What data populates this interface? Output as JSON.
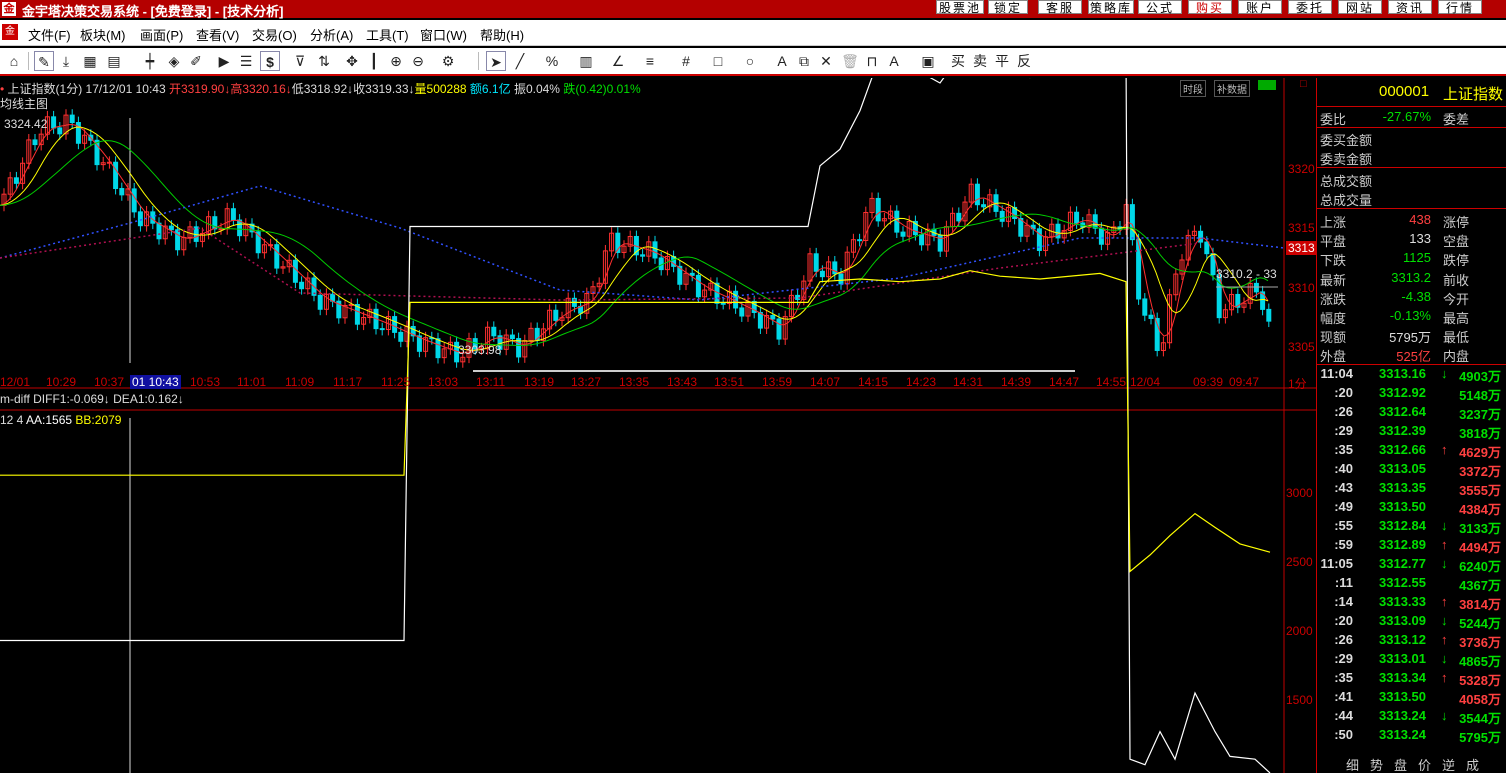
{
  "titlebar": {
    "title": "金宇塔决策交易系统 - [免费登录] - [技术分析]",
    "buttons": [
      "股票池",
      "锁定",
      "客服",
      "策略库",
      "公式",
      "购买",
      "账户",
      "委托",
      "网站",
      "资讯",
      "行情"
    ]
  },
  "menu": [
    "文件(F)",
    "板块(M)",
    "画面(P)",
    "查看(V)",
    "交易(O)",
    "分析(A)",
    "工具(T)",
    "窗口(W)",
    "帮助(H)"
  ],
  "chart": {
    "header": "上证指数(1分)  17/12/01 10:43",
    "open": "开3319.90↓",
    "high": "高3320.16↓",
    "low": "低3318.92↓",
    "close": "收3319.33↓",
    "volume": "量500288",
    "amount": "额6.1亿",
    "amplitude": "振0.04%",
    "change": "跌(0.42)0.01%",
    "main_label": "均线主图",
    "buttons": [
      "时段",
      "补数据"
    ],
    "high_label": "3324.42",
    "low_label": "3303.98",
    "right_marker_price": "3313",
    "overlay_label": "3310.2 - 33",
    "price_ticks": [
      "3320",
      "3315",
      "3310",
      "3305"
    ],
    "time_axis": [
      "12/01",
      "10:29",
      "10:37",
      "01 10:43",
      "10:53",
      "11:01",
      "11:09",
      "11:17",
      "11:25",
      "13:03",
      "13:11",
      "13:19",
      "13:27",
      "13:35",
      "13:43",
      "13:51",
      "13:59",
      "14:07",
      "14:15",
      "14:23",
      "14:31",
      "14:39",
      "14:47",
      "14:55",
      "12/04",
      "09:39",
      "09:47"
    ],
    "period_label": "1分",
    "indicator1": "m-diff  DIFF1:-0.069↓  DEA1:0.162↓",
    "indicator2_prefix": "12 4 ",
    "indicator2_aa": "AA:1565",
    "indicator2_bb": "BB:2079",
    "indicator_ticks": [
      "3000",
      "2500",
      "2000",
      "1500"
    ]
  },
  "quote": {
    "code": "000001",
    "name": "上证指数",
    "wei_bi_label": "委比",
    "wei_bi": "-27.67%",
    "wei_cha_label": "委差",
    "rows_plain": [
      "委买金额",
      "委卖金额",
      "总成交额",
      "总成交量"
    ],
    "stats": [
      {
        "l": "上涨",
        "v": "438",
        "c": "#ff4040",
        "r": "涨停"
      },
      {
        "l": "平盘",
        "v": "133",
        "c": "#dddddd",
        "r": "空盘"
      },
      {
        "l": "下跌",
        "v": "1125",
        "c": "#00e000",
        "r": "跌停"
      },
      {
        "l": "最新",
        "v": "3313.2",
        "c": "#00e000",
        "r": "前收"
      },
      {
        "l": "涨跌",
        "v": "-4.38",
        "c": "#00e000",
        "r": "今开"
      },
      {
        "l": "幅度",
        "v": "-0.13%",
        "c": "#00e000",
        "r": "最高"
      },
      {
        "l": "现额",
        "v": "5795万",
        "c": "#dddddd",
        "r": "最低"
      },
      {
        "l": "外盘",
        "v": "525亿",
        "c": "#ff4040",
        "r": "内盘"
      }
    ],
    "ticks": [
      {
        "t": "11:04",
        "p": "3313.16",
        "a": "↓",
        "v": "4903万",
        "c": "#00e000"
      },
      {
        "t": ":20",
        "p": "3312.92",
        "a": "",
        "v": "5148万",
        "c": "#00e000"
      },
      {
        "t": ":26",
        "p": "3312.64",
        "a": "",
        "v": "3237万",
        "c": "#00e000"
      },
      {
        "t": ":29",
        "p": "3312.39",
        "a": "",
        "v": "3818万",
        "c": "#00e000"
      },
      {
        "t": ":35",
        "p": "3312.66",
        "a": "↑",
        "v": "4629万",
        "c": "#ff4040"
      },
      {
        "t": ":40",
        "p": "3313.05",
        "a": "",
        "v": "3372万",
        "c": "#ff4040"
      },
      {
        "t": ":43",
        "p": "3313.35",
        "a": "",
        "v": "3555万",
        "c": "#ff4040"
      },
      {
        "t": ":49",
        "p": "3313.50",
        "a": "",
        "v": "4384万",
        "c": "#ff4040"
      },
      {
        "t": ":55",
        "p": "3312.84",
        "a": "↓",
        "v": "3133万",
        "c": "#00e000"
      },
      {
        "t": ":59",
        "p": "3312.89",
        "a": "↑",
        "v": "4494万",
        "c": "#ff4040"
      },
      {
        "t": "11:05",
        "p": "3312.77",
        "a": "↓",
        "v": "6240万",
        "c": "#00e000"
      },
      {
        "t": ":11",
        "p": "3312.55",
        "a": "",
        "v": "4367万",
        "c": "#00e000"
      },
      {
        "t": ":14",
        "p": "3313.33",
        "a": "↑",
        "v": "3814万",
        "c": "#ff4040"
      },
      {
        "t": ":20",
        "p": "3313.09",
        "a": "↓",
        "v": "5244万",
        "c": "#00e000"
      },
      {
        "t": ":26",
        "p": "3313.12",
        "a": "↑",
        "v": "3736万",
        "c": "#ff4040"
      },
      {
        "t": ":29",
        "p": "3313.01",
        "a": "↓",
        "v": "4865万",
        "c": "#00e000"
      },
      {
        "t": ":35",
        "p": "3313.34",
        "a": "↑",
        "v": "5328万",
        "c": "#ff4040"
      },
      {
        "t": ":41",
        "p": "3313.50",
        "a": "",
        "v": "4058万",
        "c": "#ff4040"
      },
      {
        "t": ":44",
        "p": "3313.24",
        "a": "↓",
        "v": "3544万",
        "c": "#00e000"
      },
      {
        "t": ":50",
        "p": "3313.24",
        "a": "",
        "v": "5795万",
        "c": "#00e000"
      }
    ],
    "bottom_tabs": "细势盘价逆成"
  },
  "colors": {
    "up": "#ff3030",
    "down": "#00d8e8",
    "ma5": "#ffffff",
    "ma10": "#ffff00",
    "ma20": "#00cc00",
    "axis": "#c00000"
  }
}
